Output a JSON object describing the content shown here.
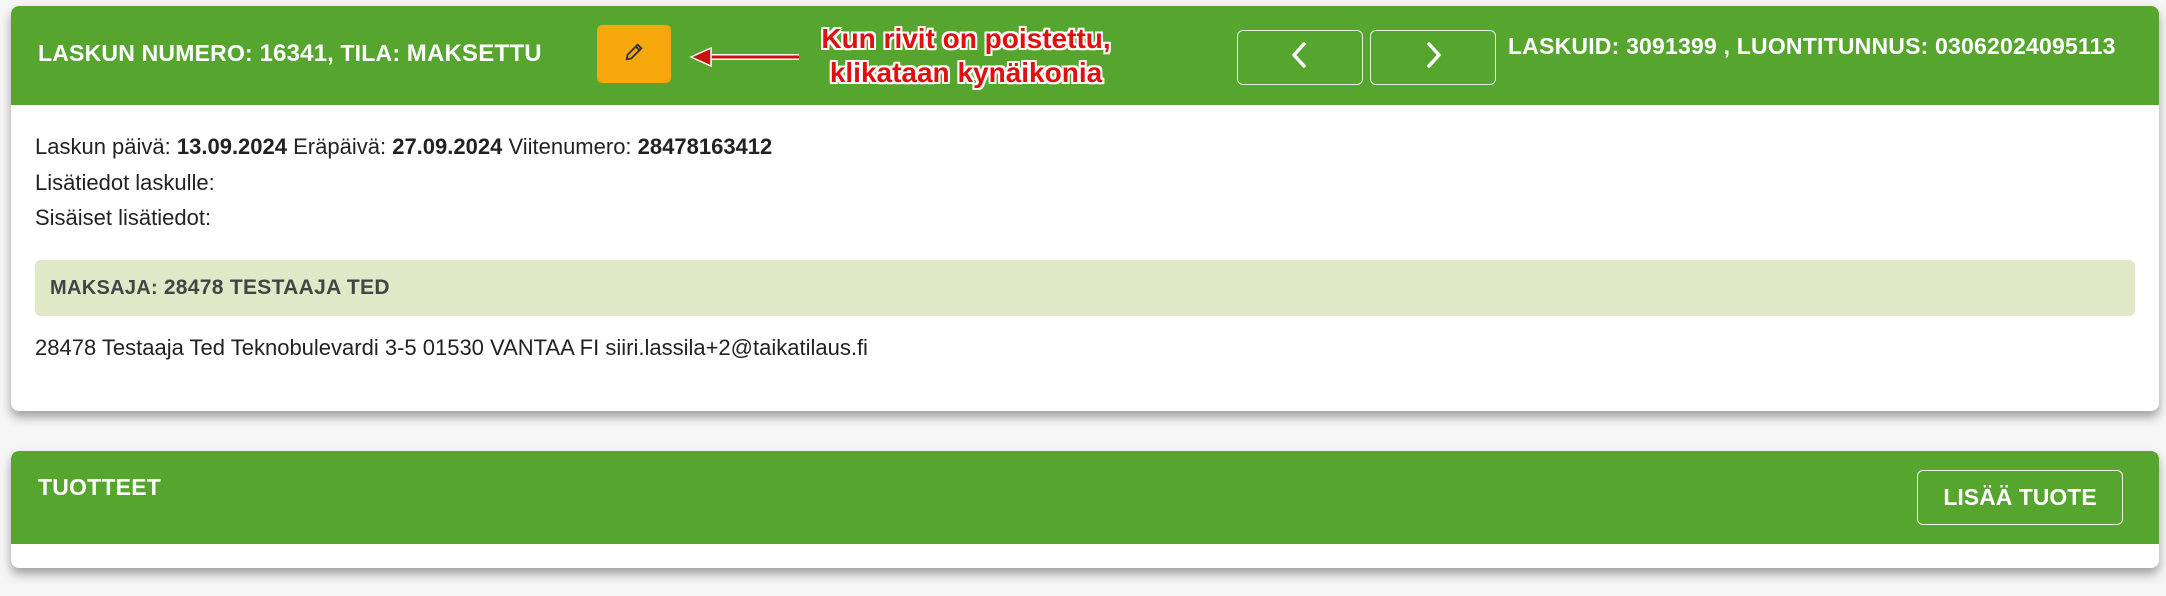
{
  "invoice": {
    "number_label": "LASKUN NUMERO:",
    "number": "16341",
    "status_label": ", TILA:",
    "status": "MAKSETTU",
    "laskuid_label": "LASKUID: 3091399 , LUONTITUNNUS: 03062024095113",
    "date_label": "Laskun päivä:",
    "date": "13.09.2024",
    "due_label": "Eräpäivä:",
    "due": "27.09.2024",
    "ref_label": "Viitenumero:",
    "ref": "28478163412",
    "info_label": "Lisätiedot laskulle:",
    "internal_label": "Sisäiset lisätiedot:",
    "payer_label": "MAKSAJA:",
    "payer": "28478 TESTAAJA TED",
    "address": "28478 Testaaja Ted Teknobulevardi 3-5 01530 VANTAA FI siiri.lassila+2@taikatilaus.fi"
  },
  "annotation": {
    "line1": "Kun rivit on poistettu,",
    "line2": "klikataan kynäikonia",
    "color": "#e01010"
  },
  "icons": {
    "edit": "pencil-icon",
    "prev": "chevron-left-icon",
    "next": "chevron-right-icon"
  },
  "products": {
    "title": "TUOTTEET",
    "add_label": "LISÄÄ TUOTE"
  },
  "colors": {
    "header_green": "#56a52e",
    "edit_orange": "#f5a70c",
    "payer_bg": "#dfe9c8"
  }
}
